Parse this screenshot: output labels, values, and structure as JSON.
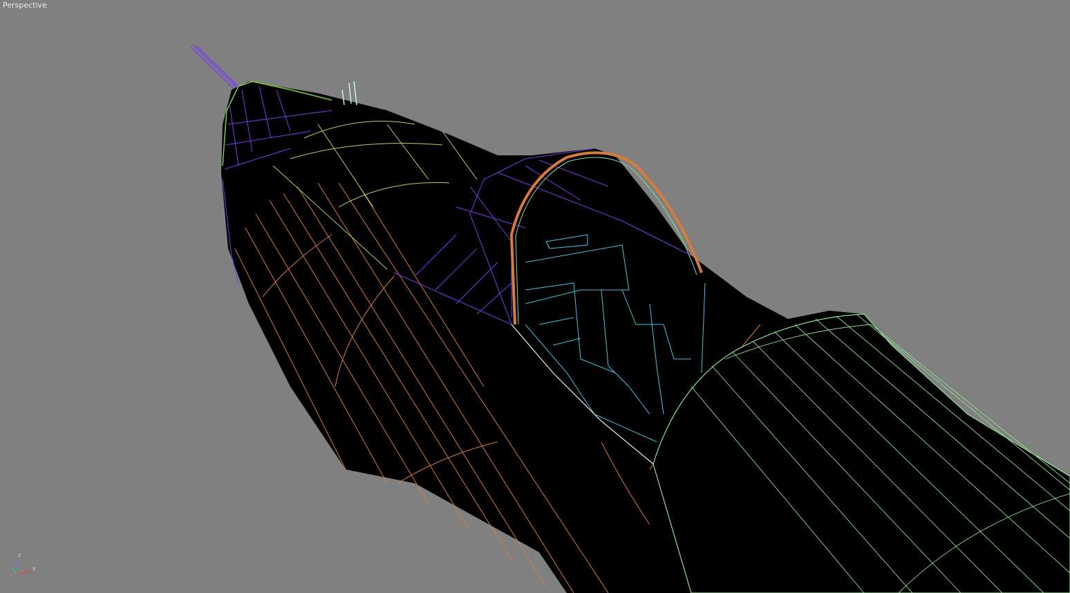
{
  "viewport": {
    "label": "Perspective",
    "background": "#808080"
  },
  "colors": {
    "mesh_fill": "#000000",
    "wire_orange": "#d87a3a",
    "wire_green": "#8ee08e",
    "wire_purple": "#7a3cf0",
    "wire_yellow_green": "#b8d45a",
    "wire_cyan": "#40c8e8",
    "wire_white": "#e8f0e8"
  },
  "gizmo": {
    "z_label": "z",
    "x_label": "x",
    "z_color": "#4080ff",
    "x_color": "#ff3030",
    "y_color": "#30e030"
  }
}
